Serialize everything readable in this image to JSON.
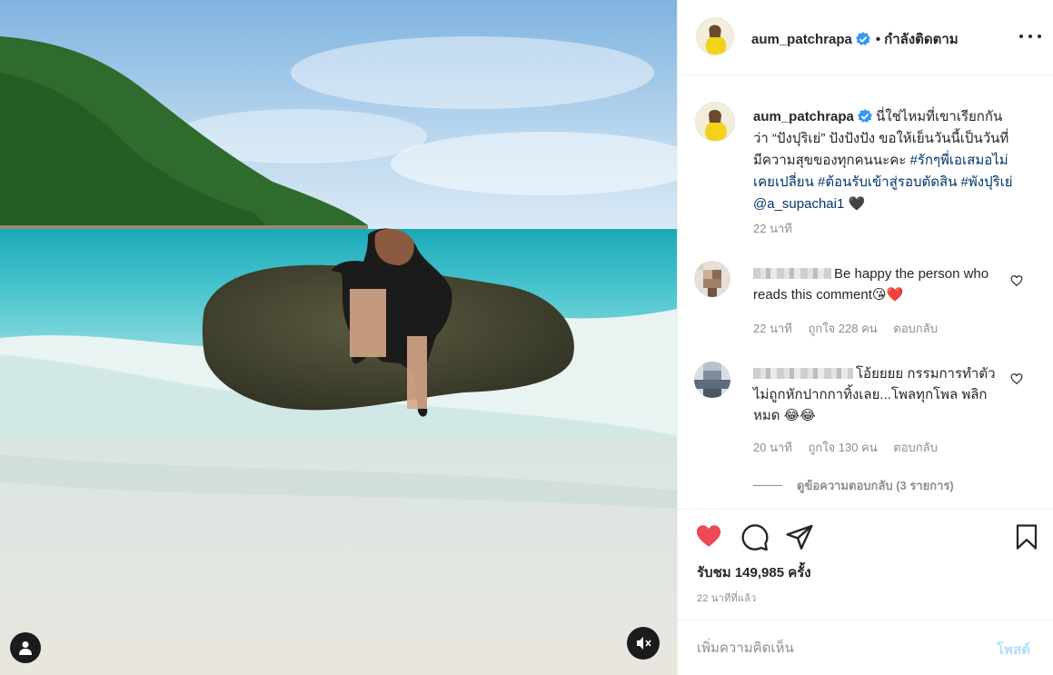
{
  "post": {
    "username": "aum_patchrapa",
    "follow_dot": "•",
    "follow_status": "กำลังติดตาม",
    "verified": true,
    "caption_body": "นี่ใช่ไหมที่เขาเรียกกันว่า “ปังปุริเย่” ปังปังปัง ขอให้เย็นวันนี้เป็นวันที่มีความสุขของทุกคนนะคะ",
    "caption_tags": "#รักๆพี่เอเสมอไม่เคยเปลี่ยน #ต้อนรับเข้าสู่รอบตัดสิน #พังปุริเย่ @a_supachai1",
    "caption_emoji": "🖤",
    "caption_time": "22 นาที"
  },
  "comments": [
    {
      "text": "Be happy the person who reads this comment😘❤️",
      "time": "22 นาที",
      "likes": "ถูกใจ 228 คน",
      "reply": "ตอบกลับ",
      "avatar_color": "#b9a38e"
    },
    {
      "text": "โอ้ยยยย กรรมการทำตัวไม่ถูกหักปากกาทิ้งเลย...โพลทุกโพล พลิกหมด 😂😂",
      "time": "20 นาที",
      "likes": "ถูกใจ 130 คน",
      "reply": "ตอบกลับ",
      "avatar_color": "#8a9bb0"
    }
  ],
  "view_replies": "ดูข้อความตอบกลับ (3 รายการ)",
  "actions": {
    "views": "รับชม 149,985 ครั้ง",
    "time_ago": "22 นาทีที่แล้ว",
    "liked": true
  },
  "add_comment": {
    "placeholder": "เพิ่มความคิดเห็น",
    "post_label": "โพสต์"
  },
  "icons": {
    "heart": "heart-icon",
    "comment": "comment-icon",
    "share": "share-icon",
    "save": "bookmark-icon",
    "more": "more-icon",
    "mute": "muted-speaker-icon",
    "user_tag": "user-icon"
  },
  "colors": {
    "heart_red": "#ed4956",
    "verified_blue": "#3897f0",
    "link_blue": "#00376b",
    "muted_text": "#8e8e8e",
    "post_disabled": "#b2dffc"
  }
}
